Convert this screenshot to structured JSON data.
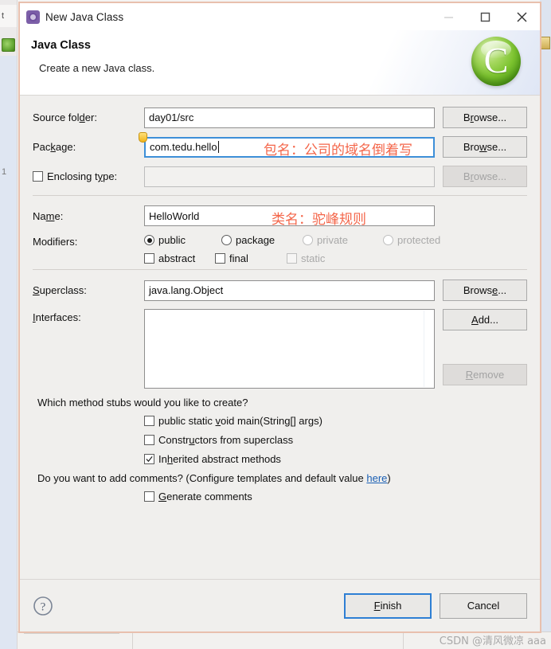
{
  "window": {
    "title": "New Java Class",
    "icon": "java-class-icon",
    "controls": {
      "minimize": "minimize-icon",
      "maximize": "maximize-icon",
      "close": "close-icon"
    }
  },
  "header": {
    "title": "Java Class",
    "subtitle": "Create a new Java class.",
    "logo_glyph": "C",
    "logo_color": "#7cc32f"
  },
  "form": {
    "source_folder": {
      "label": "Source folder:",
      "value": "day01/src",
      "button": "Browse..."
    },
    "package": {
      "label": "Package:",
      "value": "com.tedu.hello",
      "button": "Browse...",
      "focused": true,
      "marker": "warning-marker",
      "annotation": "包名：公司的域名倒着写"
    },
    "enclosing_type": {
      "label": "Enclosing type:",
      "value": "",
      "button": "Browse...",
      "checked": false,
      "disabled": true
    },
    "name": {
      "label": "Name:",
      "value": "HelloWorld",
      "annotation": "类名：驼峰规则"
    },
    "modifiers": {
      "label": "Modifiers:",
      "access": [
        {
          "label": "public",
          "selected": true,
          "disabled": false
        },
        {
          "label": "package",
          "selected": false,
          "disabled": false
        },
        {
          "label": "private",
          "selected": false,
          "disabled": true
        },
        {
          "label": "protected",
          "selected": false,
          "disabled": true
        }
      ],
      "flags": [
        {
          "label": "abstract",
          "checked": false,
          "disabled": false
        },
        {
          "label": "final",
          "checked": false,
          "disabled": false
        },
        {
          "label": "static",
          "checked": false,
          "disabled": true
        }
      ]
    },
    "superclass": {
      "label": "Superclass:",
      "value": "java.lang.Object",
      "button": "Browse..."
    },
    "interfaces": {
      "label": "Interfaces:",
      "items": [],
      "add_button": "Add...",
      "remove_button": "Remove",
      "remove_disabled": true
    }
  },
  "stubs": {
    "question": "Which method stubs would you like to create?",
    "options": [
      {
        "label": "public static void main(String[] args)",
        "checked": false
      },
      {
        "label": "Constructors from superclass",
        "checked": false
      },
      {
        "label": "Inherited abstract methods",
        "checked": true
      }
    ]
  },
  "comments": {
    "question_prefix": "Do you want to add comments? (Configure templates and default value ",
    "link": "here",
    "question_suffix": ")",
    "option": {
      "label": "Generate comments",
      "checked": false
    }
  },
  "footer": {
    "help": "help-icon",
    "finish": "Finish",
    "cancel": "Cancel",
    "default_button": "Finish"
  },
  "watermark": "CSDN @清风微凉 aaa",
  "background": {
    "left_tab": "t",
    "left_number": "1"
  }
}
